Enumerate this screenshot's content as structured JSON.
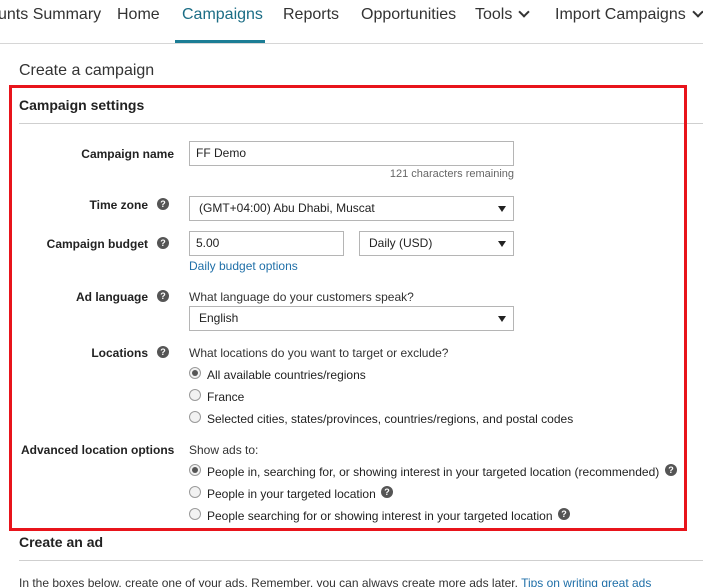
{
  "nav": {
    "items": [
      "unts Summary",
      "Home",
      "Campaigns",
      "Reports",
      "Opportunities",
      "Tools",
      "Import Campaigns"
    ],
    "active": "Campaigns"
  },
  "page": {
    "title": "Create a campaign"
  },
  "campaign_settings": {
    "title": "Campaign settings",
    "campaign_name": {
      "label": "Campaign name",
      "value": "FF Demo",
      "chars_remaining": "121 characters remaining"
    },
    "time_zone": {
      "label": "Time zone",
      "value": "(GMT+04:00) Abu Dhabi, Muscat"
    },
    "budget": {
      "label": "Campaign budget",
      "value": "5.00",
      "period": "Daily (USD)",
      "options_link": "Daily budget options"
    },
    "ad_language": {
      "label": "Ad language",
      "question": "What language do your customers speak?",
      "value": "English"
    },
    "locations": {
      "label": "Locations",
      "question": "What locations do you want to target or exclude?",
      "options": [
        {
          "label": "All available countries/regions",
          "selected": true
        },
        {
          "label": "France",
          "selected": false
        },
        {
          "label": "Selected cities, states/provinces, countries/regions, and postal codes",
          "selected": false
        }
      ]
    },
    "advanced_location": {
      "label": "Advanced location options",
      "question": "Show ads to:",
      "options": [
        {
          "label": "People in, searching for, or showing interest in your targeted location (recommended)",
          "selected": true
        },
        {
          "label": "People in your targeted location",
          "selected": false
        },
        {
          "label": "People searching for or showing interest in your targeted location",
          "selected": false
        }
      ]
    }
  },
  "create_ad": {
    "title": "Create an ad",
    "description": "In the boxes below, create one of your ads. Remember, you can always create more ads later.",
    "tips_link": "Tips on writing great ads"
  },
  "colors": {
    "accent": "#1b7d95",
    "highlight": "#e8141b",
    "link": "#1f6fa8"
  }
}
